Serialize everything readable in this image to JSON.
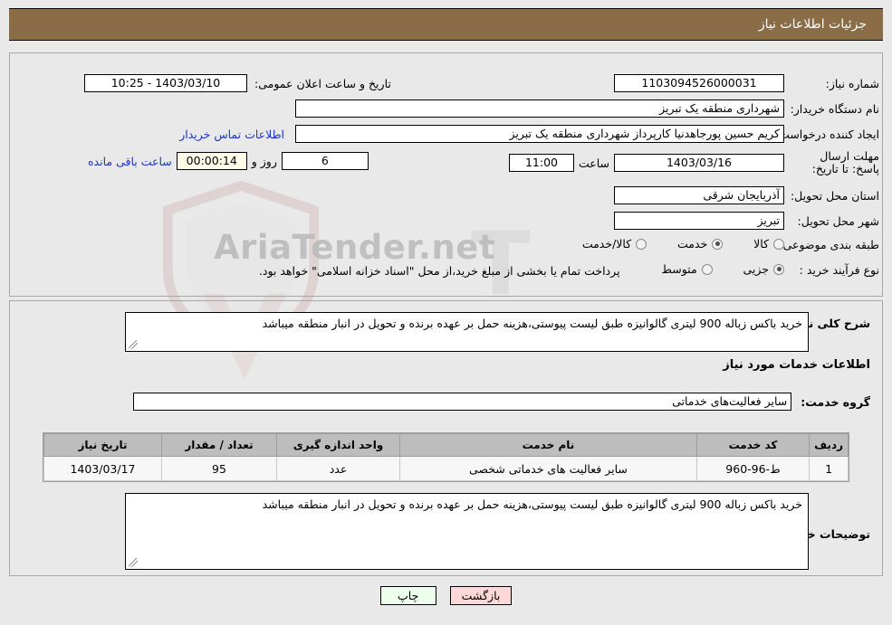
{
  "header": {
    "title": "جزئیات اطلاعات نیاز"
  },
  "form": {
    "need_number": {
      "label": "شماره نیاز:",
      "value": "1103094526000031"
    },
    "buyer_org": {
      "label": "نام دستگاه خریدار:",
      "value": "شهرداری منطقه یک تبریز"
    },
    "requester": {
      "label": "ایجاد کننده درخواست:",
      "value": "کریم حسین پورجاهدنیا کارپرداز شهرداری منطقه یک تبریز"
    },
    "deadline": {
      "label": "مهلت ارسال پاسخ: تا تاریخ:",
      "date": "1403/03/16",
      "time_label": "ساعت",
      "time": "11:00"
    },
    "announce": {
      "label": "تاریخ و ساعت اعلان عمومی:",
      "value": "1403/03/10 - 10:25"
    },
    "contact_link": "اطلاعات تماس خریدار",
    "remaining": {
      "days": "6",
      "days_label": "روز و",
      "timer": "00:00:14",
      "suffix_label": "ساعت باقی مانده"
    },
    "province": {
      "label": "استان محل تحویل:",
      "value": "آذربایجان شرقی"
    },
    "city": {
      "label": "شهر محل تحویل:",
      "value": "تبریز"
    },
    "category": {
      "label": "طبقه بندی موضوعی:",
      "options": [
        "کالا",
        "خدمت",
        "کالا/خدمت"
      ],
      "selected": "خدمت"
    },
    "purchase_type": {
      "label": "نوع فرآیند خرید :",
      "options": [
        "جزیی",
        "متوسط"
      ],
      "selected": "جزیی",
      "note": "پرداخت تمام یا بخشی از مبلغ خرید،از محل \"اسناد خزانه اسلامی\" خواهد بود."
    },
    "summary": {
      "label": "شرح کلی نیاز:",
      "value": "خرید باکس زباله 900 لیتری گالوانیزه طبق لیست پیوستی،هزینه حمل بر عهده برنده و تحویل در انبار منطقه میباشد"
    },
    "services_heading": "اطلاعات خدمات مورد نیاز",
    "service_group": {
      "label": "گروه خدمت:",
      "value": "سایر فعالیت‌های خدماتی"
    },
    "buyer_notes": {
      "label": "توضیحات خریدار:",
      "value": "خرید باکس زباله 900 لیتری گالوانیزه طبق لیست پیوستی،هزینه حمل بر عهده برنده و تحویل در انبار منطقه میباشد"
    }
  },
  "table": {
    "columns": [
      "ردیف",
      "کد خدمت",
      "نام خدمت",
      "واحد اندازه گیری",
      "تعداد / مقدار",
      "تاریخ نیاز"
    ],
    "rows": [
      {
        "row": "1",
        "code": "ط-96-960",
        "name": "سایر فعالیت های خدماتی شخصی",
        "unit": "عدد",
        "qty": "95",
        "need_date": "1403/03/17"
      }
    ]
  },
  "buttons": {
    "print": "چاپ",
    "back": "بازگشت"
  },
  "watermark": {
    "text": "AriaTender.net",
    "brand_letter": "T"
  },
  "colors": {
    "header_bg": "#8a6d47",
    "link": "#1a34c8",
    "timer_bg": "#fffde8",
    "back_btn": "#ffd9d9",
    "print_btn": "#ebffeb"
  }
}
